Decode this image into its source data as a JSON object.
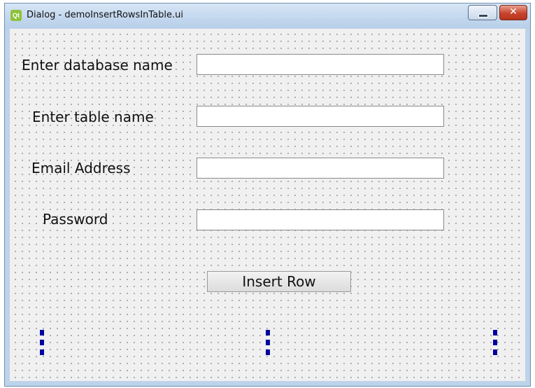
{
  "window": {
    "title": "Dialog - demoInsertRowsInTable.ui",
    "app_icon": "Qt",
    "minimize_icon": "minimize-icon",
    "close_label": "✕"
  },
  "form": {
    "database_label": "Enter database name",
    "database_value": "",
    "table_label": "Enter table name",
    "table_value": "",
    "email_label": "Email Address",
    "email_value": "",
    "password_label": "Password",
    "password_value": ""
  },
  "actions": {
    "insert_row_label": "Insert Row"
  },
  "colors": {
    "selection_marker": "#0000a0",
    "canvas_bg": "#f0f0f0",
    "titlebar": "#c2d7ee",
    "close_button": "#c7442c"
  }
}
